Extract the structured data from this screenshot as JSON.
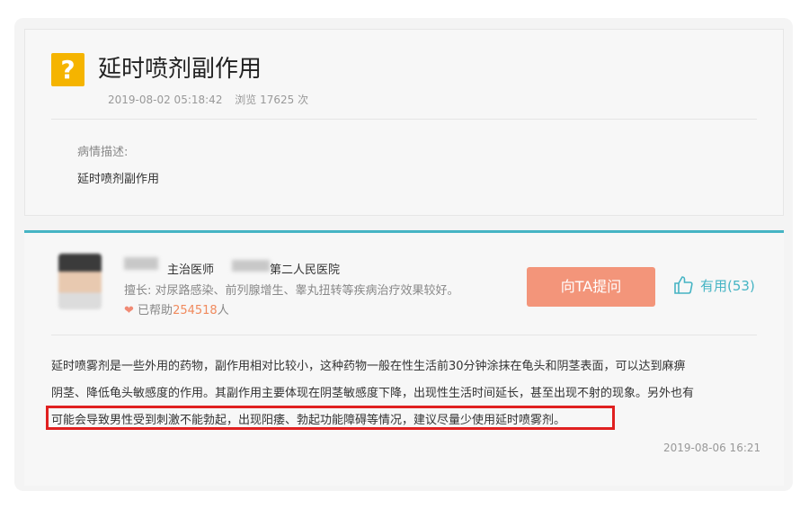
{
  "question": {
    "icon": "?",
    "title": "延时喷剂副作用",
    "date": "2019-08-02 05:18:42",
    "views": "浏览 17625 次",
    "desc_label": "病情描述:",
    "desc_text": "延时喷剂副作用"
  },
  "doctor": {
    "title": "主治医师",
    "hospital": "第二人民医院",
    "specialty": "擅长: 对尿路感染、前列腺增生、睾丸扭转等疾病治疗效果较好。",
    "heart": "❤",
    "helped_prefix": "已帮助",
    "helped_count": "254518",
    "helped_suffix": "人"
  },
  "actions": {
    "ask_label": "向TA提问",
    "useful_label": "有用(53)"
  },
  "answer": {
    "line1": "延时喷雾剂是一些外用的药物，副作用相对比较小，这种药物一般在性生活前30分钟涂抹在龟头和阴茎表面，可以达到麻痹",
    "line2": "阴茎、降低龟头敏感度的作用。其副作用主要体现在阴茎敏感度下降，出现性生活时间延长，甚至出现不射的现象。另外也有",
    "line3": "可能会导致男性受到刺激不能勃起，出现阳痿、勃起功能障碍等情况，建议尽量少使用延时喷雾剂。",
    "date": "2019-08-06 16:21"
  },
  "colors": {
    "accent": "#46b4c4",
    "button": "#f3957a",
    "icon_bg": "#f5b400",
    "highlight": "#e02020"
  }
}
